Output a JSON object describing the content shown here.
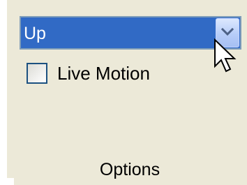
{
  "select": {
    "selected_value": "Up"
  },
  "live_motion": {
    "label": "Live Motion",
    "checked": false
  },
  "group": {
    "label": "Options"
  },
  "colors": {
    "panel_bg": "#ece9d8",
    "selection_bg": "#316ac5",
    "field_border": "#7f9db9",
    "checkbox_border": "#1c5180"
  },
  "icons": {
    "dropdown": "chevron-down-icon",
    "cursor": "mouse-pointer-icon"
  }
}
